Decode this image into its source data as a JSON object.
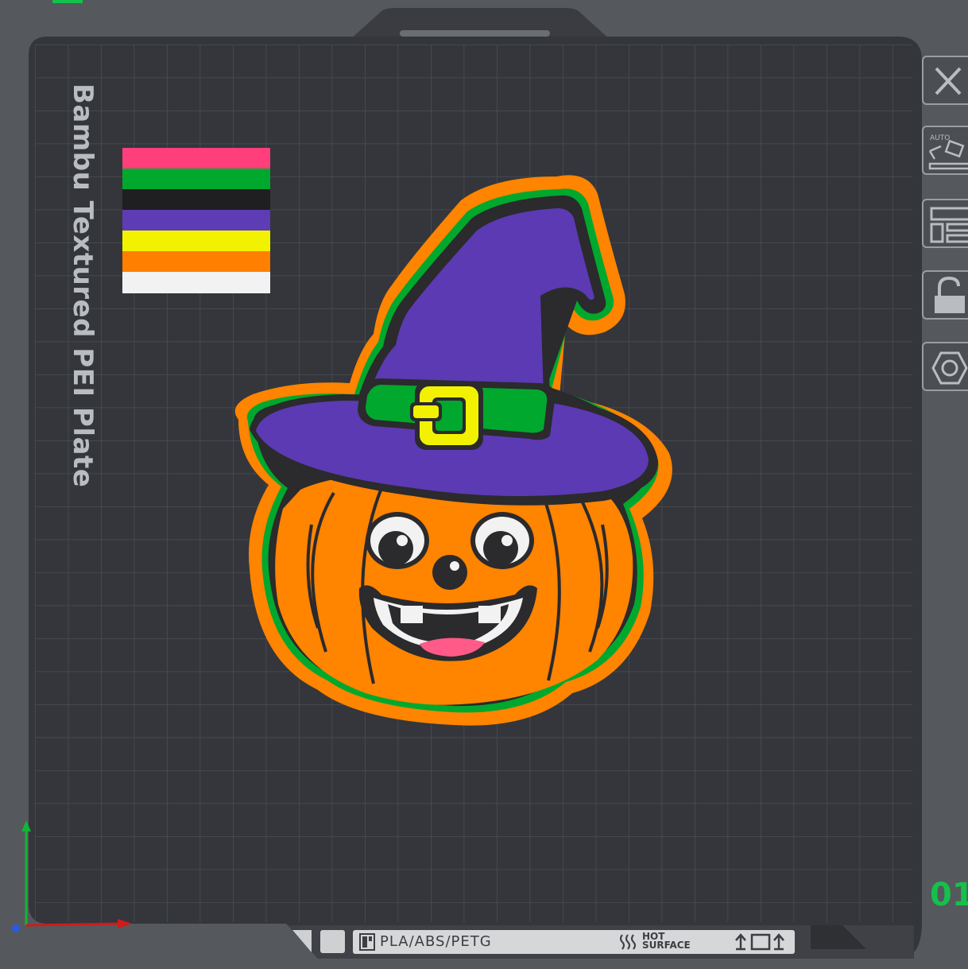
{
  "plate": {
    "label": "Bambu Textured PEI Plate",
    "number": "01",
    "filament_type": "PLA/ABS/PETG",
    "hot_surface_line1": "HOT",
    "hot_surface_line2": "SURFACE"
  },
  "toolbar": [
    {
      "name": "close-button",
      "icon": "close-icon"
    },
    {
      "name": "auto-orient-button",
      "icon": "auto-orient-icon",
      "text": "AUTO"
    },
    {
      "name": "arrange-button",
      "icon": "arrange-icon"
    },
    {
      "name": "lock-button",
      "icon": "unlock-icon"
    },
    {
      "name": "settings-button",
      "icon": "hexagon-nut-icon"
    }
  ],
  "filament_colors": [
    "#ff3f7b",
    "#00a82d",
    "#1f1f21",
    "#5e3cb5",
    "#f2f200",
    "#ff8000",
    "#f2f2f2"
  ],
  "colors": {
    "background": "#55585d",
    "plate": "#34363b",
    "grid": "#4a4d52",
    "accent": "#14c14a",
    "orange": "#ff8400",
    "purple": "#5b3ab3",
    "green": "#00a82d",
    "yellow": "#f2f200"
  }
}
